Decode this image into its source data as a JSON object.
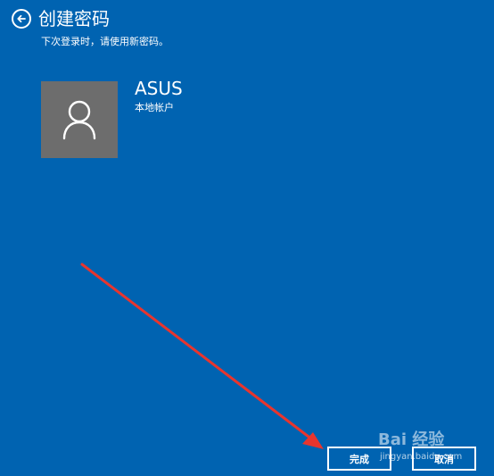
{
  "colors": {
    "background": "#0063b1",
    "avatar_background": "#6d6d6d",
    "text": "#ffffff",
    "annotation_arrow": "#e8352e"
  },
  "header": {
    "back_icon": "back-arrow-circle-icon",
    "title": "创建密码",
    "subtitle": "下次登录时，请使用新密码。"
  },
  "account": {
    "avatar_icon": "user-icon",
    "name": "ASUS",
    "type": "本地帐户"
  },
  "footer": {
    "finish_label": "完成",
    "cancel_label": "取消"
  },
  "watermark": {
    "logo": "Bai 经验",
    "url": "jingyan.baidu.com"
  }
}
